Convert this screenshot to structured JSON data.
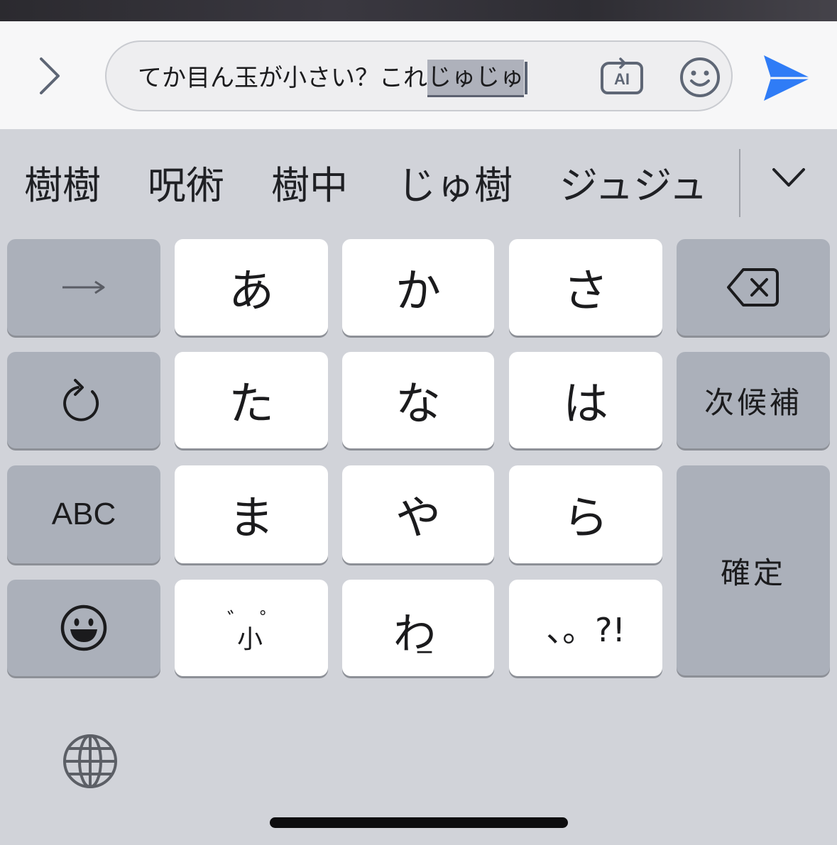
{
  "composer": {
    "message_prefix": "てか目ん玉が小さい？これ",
    "marked_text": "じゅじゅ"
  },
  "icons": {
    "expand": "chevron-right-icon",
    "ai": "ai-assistant-icon",
    "ai_label": "AI",
    "emoji": "smiley-face-icon",
    "send": "send-arrow-icon",
    "candidates_more": "chevron-down-icon",
    "next_key": "arrow-right-icon",
    "undo_key": "undo-icon",
    "emoji_key": "grinning-face-icon",
    "delete_key": "delete-backspace-icon",
    "globe": "globe-icon"
  },
  "candidates": [
    "樹樹",
    "呪術",
    "樹中",
    "じゅ樹",
    "ジュジュ"
  ],
  "keyboard": {
    "row1": [
      "あ",
      "か",
      "さ"
    ],
    "row2": [
      "た",
      "な",
      "は"
    ],
    "row3": [
      "ま",
      "や",
      "ら"
    ],
    "next_candidate": "次候補",
    "abc": "ABC",
    "confirm": "確定",
    "dakuten": "゛゜",
    "dakuten_small": "小",
    "wa_base": "わ",
    "wa_extra": "_",
    "punct": "、。?!"
  },
  "colors": {
    "accent_send": "#2f7cf6",
    "icon_gray": "#5e6675",
    "keyboard_bg": "#d1d3d9",
    "key_light": "#ffffff",
    "key_dark": "#abb0ba"
  }
}
